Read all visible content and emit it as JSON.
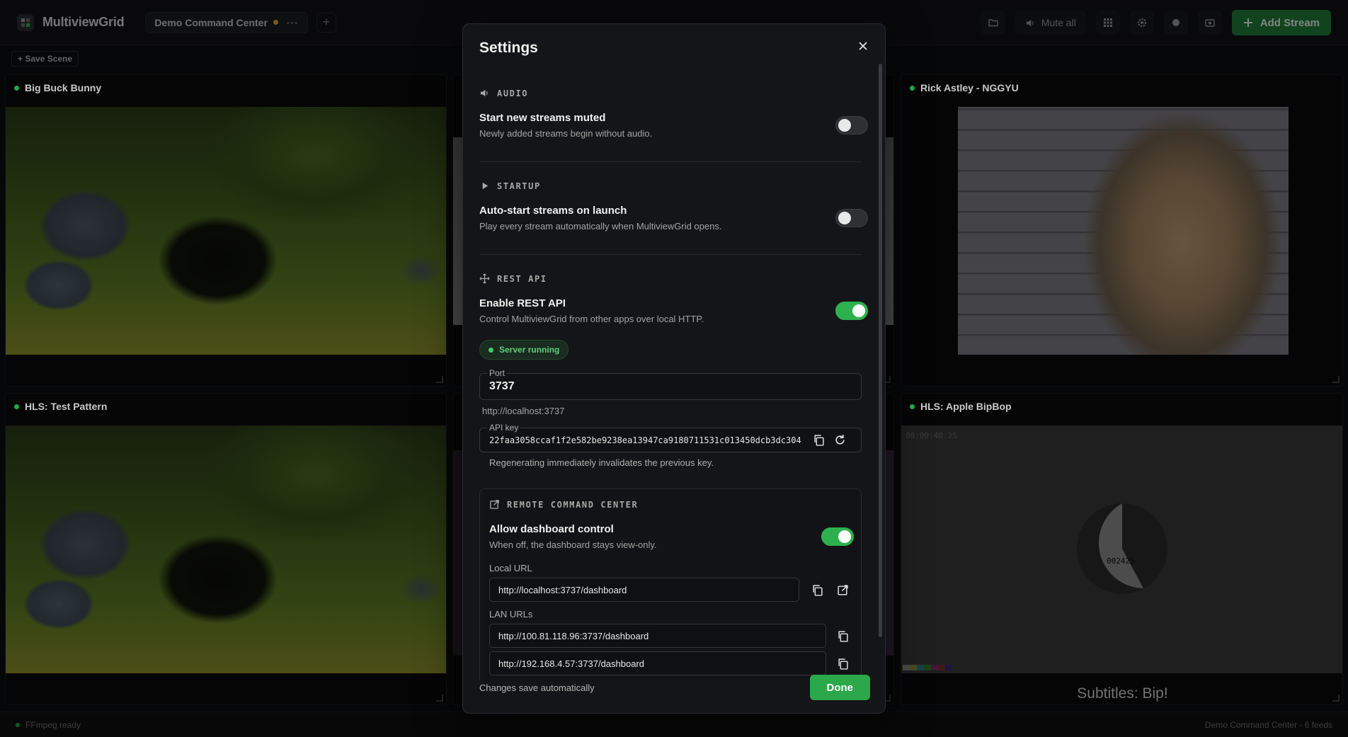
{
  "app": {
    "title": "MultiviewGrid",
    "tab_name": "Demo Command Center",
    "tab_more": "···",
    "tab_add": "+"
  },
  "toolbar": {
    "mute_all": "Mute all",
    "add_stream": "Add Stream",
    "save_scene": "+ Save Scene"
  },
  "streams": [
    {
      "name": "Big Buck Bunny"
    },
    {
      "name": "Rick Astley - NGGYU"
    },
    {
      "name": "HLS: Test Pattern"
    },
    {
      "name": "HLS: Apple BipBop",
      "timecode": "00:00:40.25",
      "counter": "002425",
      "subtitle": "Subtitles: Bip!"
    }
  ],
  "statusbar": {
    "left": "FFmpeg ready",
    "right": "Demo Command Center · 6 feeds"
  },
  "modal": {
    "title": "Settings",
    "audio": {
      "section": "AUDIO",
      "setting_title": "Start new streams muted",
      "setting_desc": "Newly added streams begin without audio.",
      "enabled": false
    },
    "startup": {
      "section": "STARTUP",
      "setting_title": "Auto-start streams on launch",
      "setting_desc": "Play every stream automatically when MultiviewGrid opens.",
      "enabled": false
    },
    "rest_api": {
      "section": "REST API",
      "setting_title": "Enable REST API",
      "setting_desc": "Control MultiviewGrid from other apps over local HTTP.",
      "enabled": true,
      "status": "Server running",
      "port_label": "Port",
      "port": "3737",
      "port_url": "http://localhost:3737",
      "api_key_label": "API key",
      "api_key": "22faa3058ccaf1f2e582be9238ea13947ca9180711531c013450dcb3dc304",
      "api_key_note": "Regenerating immediately invalidates the previous key."
    },
    "remote": {
      "section": "REMOTE COMMAND CENTER",
      "setting_title": "Allow dashboard control",
      "setting_desc": "When off, the dashboard stays view-only.",
      "enabled": true,
      "local_url_label": "Local URL",
      "local_url": "http://localhost:3737/dashboard",
      "lan_urls_label": "LAN URLs",
      "lan_urls": [
        "http://100.81.118.96:3737/dashboard",
        "http://192.168.4.57:3737/dashboard"
      ]
    },
    "footer_note": "Changes save automatically",
    "done": "Done"
  },
  "colors": {
    "accent_green": "#2aa84a",
    "toggle_on": "#2db14e",
    "status_green": "#22a845"
  }
}
